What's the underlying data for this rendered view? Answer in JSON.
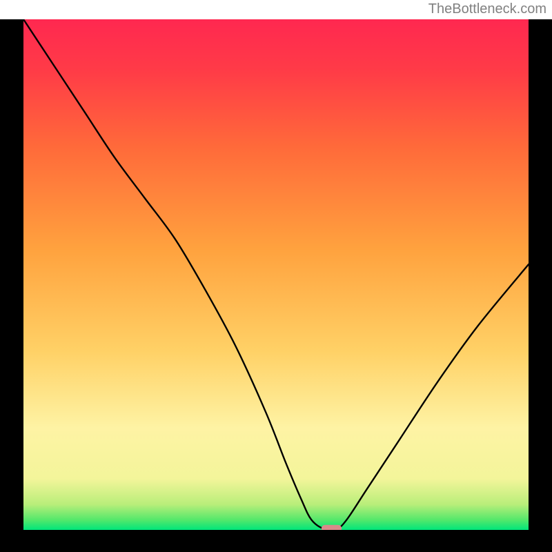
{
  "attribution": "TheBottleneck.com",
  "chart_data": {
    "type": "line",
    "title": "",
    "xlabel": "",
    "ylabel": "",
    "xlim": [
      0,
      100
    ],
    "ylim": [
      0,
      100
    ],
    "note": "Single black curve on a vertical green-yellow-red gradient. Y values read off the figure (0 = bottom / green, 100 = top / red). X is approximate horizontal position in percent.",
    "series": [
      {
        "name": "bottleneck-curve",
        "x": [
          0,
          6,
          12,
          18,
          24,
          30,
          36,
          42,
          48,
          52,
          55,
          57,
          59.5,
          62,
          64,
          68,
          74,
          82,
          90,
          100
        ],
        "y": [
          100,
          91,
          82,
          73,
          65,
          57,
          47,
          36,
          23,
          13,
          6,
          2,
          0.2,
          0.2,
          2,
          8,
          17,
          29,
          40,
          52
        ]
      }
    ],
    "marker": {
      "name": "optimum-marker",
      "x_range": [
        59,
        63
      ],
      "y": 0.3,
      "color": "#d98a8a"
    },
    "background_gradient": {
      "stops": [
        {
          "pos": 0.0,
          "color": "#00e57a"
        },
        {
          "pos": 0.02,
          "color": "#55e86b"
        },
        {
          "pos": 0.05,
          "color": "#b9ee7a"
        },
        {
          "pos": 0.1,
          "color": "#f3f59a"
        },
        {
          "pos": 0.2,
          "color": "#fef3a4"
        },
        {
          "pos": 0.35,
          "color": "#ffd166"
        },
        {
          "pos": 0.55,
          "color": "#ffa23e"
        },
        {
          "pos": 0.75,
          "color": "#ff6a3a"
        },
        {
          "pos": 0.9,
          "color": "#ff3b47"
        },
        {
          "pos": 1.0,
          "color": "#ff2850"
        }
      ]
    }
  }
}
